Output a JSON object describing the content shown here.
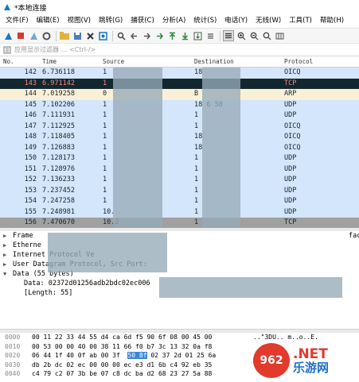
{
  "window": {
    "title": "*本地连接"
  },
  "menu": [
    "文件(F)",
    "编辑(E)",
    "视图(V)",
    "跳转(G)",
    "捕获(C)",
    "分析(A)",
    "统计(S)",
    "电话(Y)",
    "无线(W)",
    "工具(T)",
    "帮助(H)"
  ],
  "filter": {
    "placeholder": "应用显示过滤器 … <Ctrl-/>"
  },
  "columns": {
    "no": "No.",
    "time": "Time",
    "source": "Source",
    "destination": "Destination",
    "protocol": "Protocol"
  },
  "packets": [
    {
      "no": "142",
      "time": "6.736118",
      "src": "1",
      "dst": "18",
      "proto": "OICQ",
      "bg": "#d4e6fb",
      "fg": "#12272e"
    },
    {
      "no": "143",
      "time": "6.971142",
      "src": "1",
      "dst": "",
      "proto": "TCP",
      "bg": "#12272e",
      "fg": "#f78787"
    },
    {
      "no": "144",
      "time": "7.019258",
      "src": "0",
      "dst": "B",
      "proto": "ARP",
      "bg": "#faf0d7",
      "fg": "#12272e"
    },
    {
      "no": "145",
      "time": "7.102206",
      "src": "1",
      "dst": "18 6 50",
      "proto": "UDP",
      "bg": "#d4e6fb",
      "fg": "#12272e"
    },
    {
      "no": "146",
      "time": "7.111931",
      "src": "1",
      "dst": "1",
      "proto": "UDP",
      "bg": "#d4e6fb",
      "fg": "#12272e"
    },
    {
      "no": "147",
      "time": "7.112925",
      "src": "1",
      "dst": "1",
      "proto": "OICQ",
      "bg": "#d4e6fb",
      "fg": "#12272e"
    },
    {
      "no": "148",
      "time": "7.118405",
      "src": "1",
      "dst": "18",
      "proto": "OICQ",
      "bg": "#d4e6fb",
      "fg": "#12272e"
    },
    {
      "no": "149",
      "time": "7.126883",
      "src": "1",
      "dst": "18",
      "proto": "OICQ",
      "bg": "#d4e6fb",
      "fg": "#12272e"
    },
    {
      "no": "150",
      "time": "7.128173",
      "src": "1",
      "dst": "1",
      "proto": "UDP",
      "bg": "#d4e6fb",
      "fg": "#12272e"
    },
    {
      "no": "151",
      "time": "7.128976",
      "src": "1",
      "dst": "1",
      "proto": "UDP",
      "bg": "#d4e6fb",
      "fg": "#12272e"
    },
    {
      "no": "152",
      "time": "7.136233",
      "src": "1",
      "dst": "1",
      "proto": "UDP",
      "bg": "#d4e6fb",
      "fg": "#12272e"
    },
    {
      "no": "153",
      "time": "7.237452",
      "src": "1",
      "dst": "1",
      "proto": "UDP",
      "bg": "#d4e6fb",
      "fg": "#12272e"
    },
    {
      "no": "154",
      "time": "7.247258",
      "src": "1",
      "dst": "1",
      "proto": "UDP",
      "bg": "#d4e6fb",
      "fg": "#12272e"
    },
    {
      "no": "155",
      "time": "7.248981",
      "src": "10.",
      "dst": "1",
      "proto": "UDP",
      "bg": "#d4e6fb",
      "fg": "#12272e"
    },
    {
      "no": "156",
      "time": "7.470670",
      "src": "10.2",
      "dst": "1",
      "proto": "TCP",
      "bg": "#a0a0a0",
      "fg": "#12272e"
    }
  ],
  "detail": [
    {
      "arrow": "▶",
      "label": "Frame",
      "child": false
    },
    {
      "arrow": "▶",
      "label": "Etherne",
      "child": false
    },
    {
      "arrow": "▶",
      "label": "Internet Protocol Ve",
      "child": false
    },
    {
      "arrow": "▶",
      "label": "User Datagram Protocol, Src Port:",
      "child": false
    },
    {
      "arrow": "▼",
      "label": "Data (55 bytes)",
      "child": false
    },
    {
      "arrow": "",
      "label": "Data: 02372d01256adb2bdc02ec006",
      "child": true
    },
    {
      "arrow": "",
      "label": "[Length: 55]",
      "child": true
    }
  ],
  "detail_side": "fac",
  "hex": [
    {
      "off": "0000",
      "bytes": "00 11 22 33 44 55 d4 ca  6d f5 90 6f 08 00 45 00",
      "ascii": "..\"3DU.. m..o..E."
    },
    {
      "off": "0010",
      "bytes": "00 53 00 00 40 00 38 11  66 f0 b7 3c 13 32 0a f8",
      "ascii": ""
    },
    {
      "off": "0020",
      "bytes_pre": "06 44 1f 40 0f ab 00 3f  ",
      "bytes_hl": "50 8f",
      "bytes_post": " 02 37 2d 01 25 6a",
      "ascii": ""
    },
    {
      "off": "0030",
      "bytes": "db 2b dc 02 ec 00 00 00  ec e3 d1 6b c4 92 eb 35",
      "ascii": ""
    },
    {
      "off": "0040",
      "bytes": "c4 79 c2 07 3b be 07 c8  dc ba d2 68 23 27 5a 88",
      "ascii": ""
    }
  ],
  "watermark": {
    "badge": "962",
    "top": ".NET",
    "bottom": "乐游网"
  }
}
